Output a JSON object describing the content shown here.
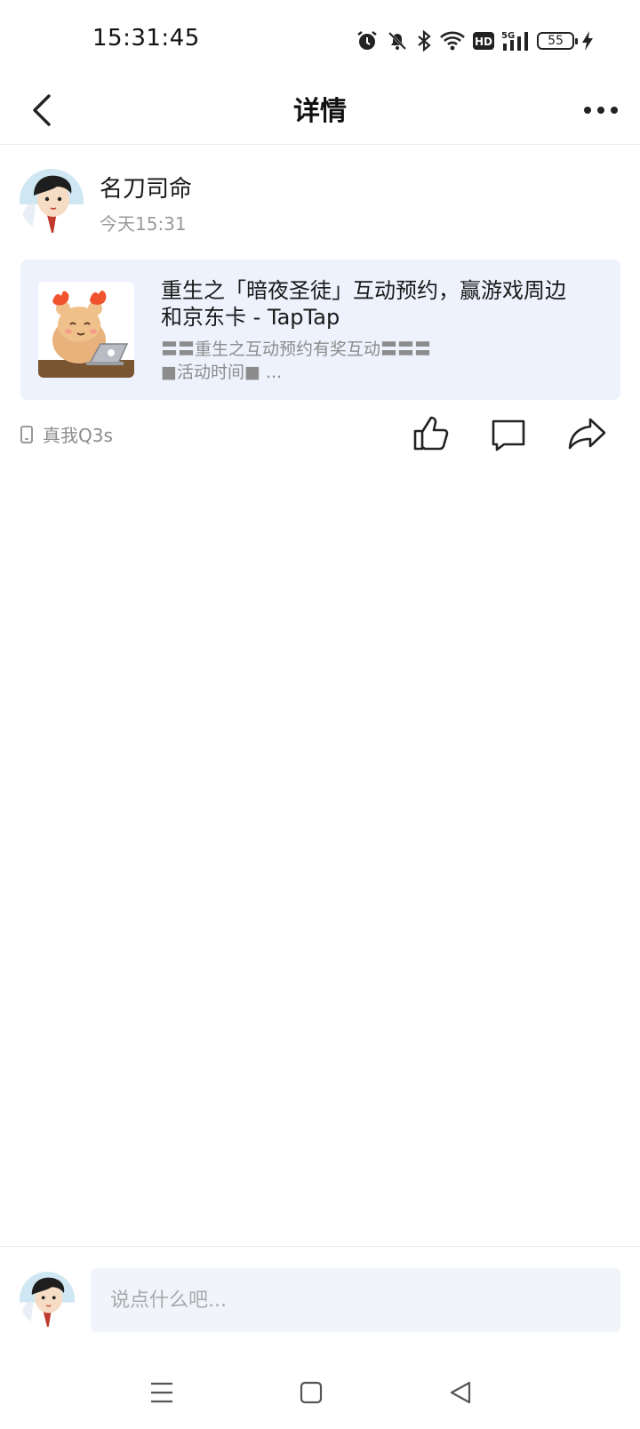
{
  "status_bar": {
    "time": "15:31:45",
    "battery": "55",
    "network": "5G",
    "hd": "HD"
  },
  "header": {
    "title": "详情"
  },
  "author": {
    "name": "名刀司命",
    "time": "今天15:31"
  },
  "link_card": {
    "title": "重生之「暗夜圣徒」互动预约，赢游戏周边和京东卡 - TapTap",
    "desc_line1": "〓〓重生之互动预约有奖互动〓〓〓",
    "desc_line2": "■活动时间■ ..."
  },
  "meta": {
    "device": "真我Q3s"
  },
  "comment": {
    "placeholder": "说点什么吧..."
  },
  "colors": {
    "card_bg": "#edf2fc",
    "input_bg": "#f1f4fb",
    "secondary_text": "#8c8c8c"
  }
}
